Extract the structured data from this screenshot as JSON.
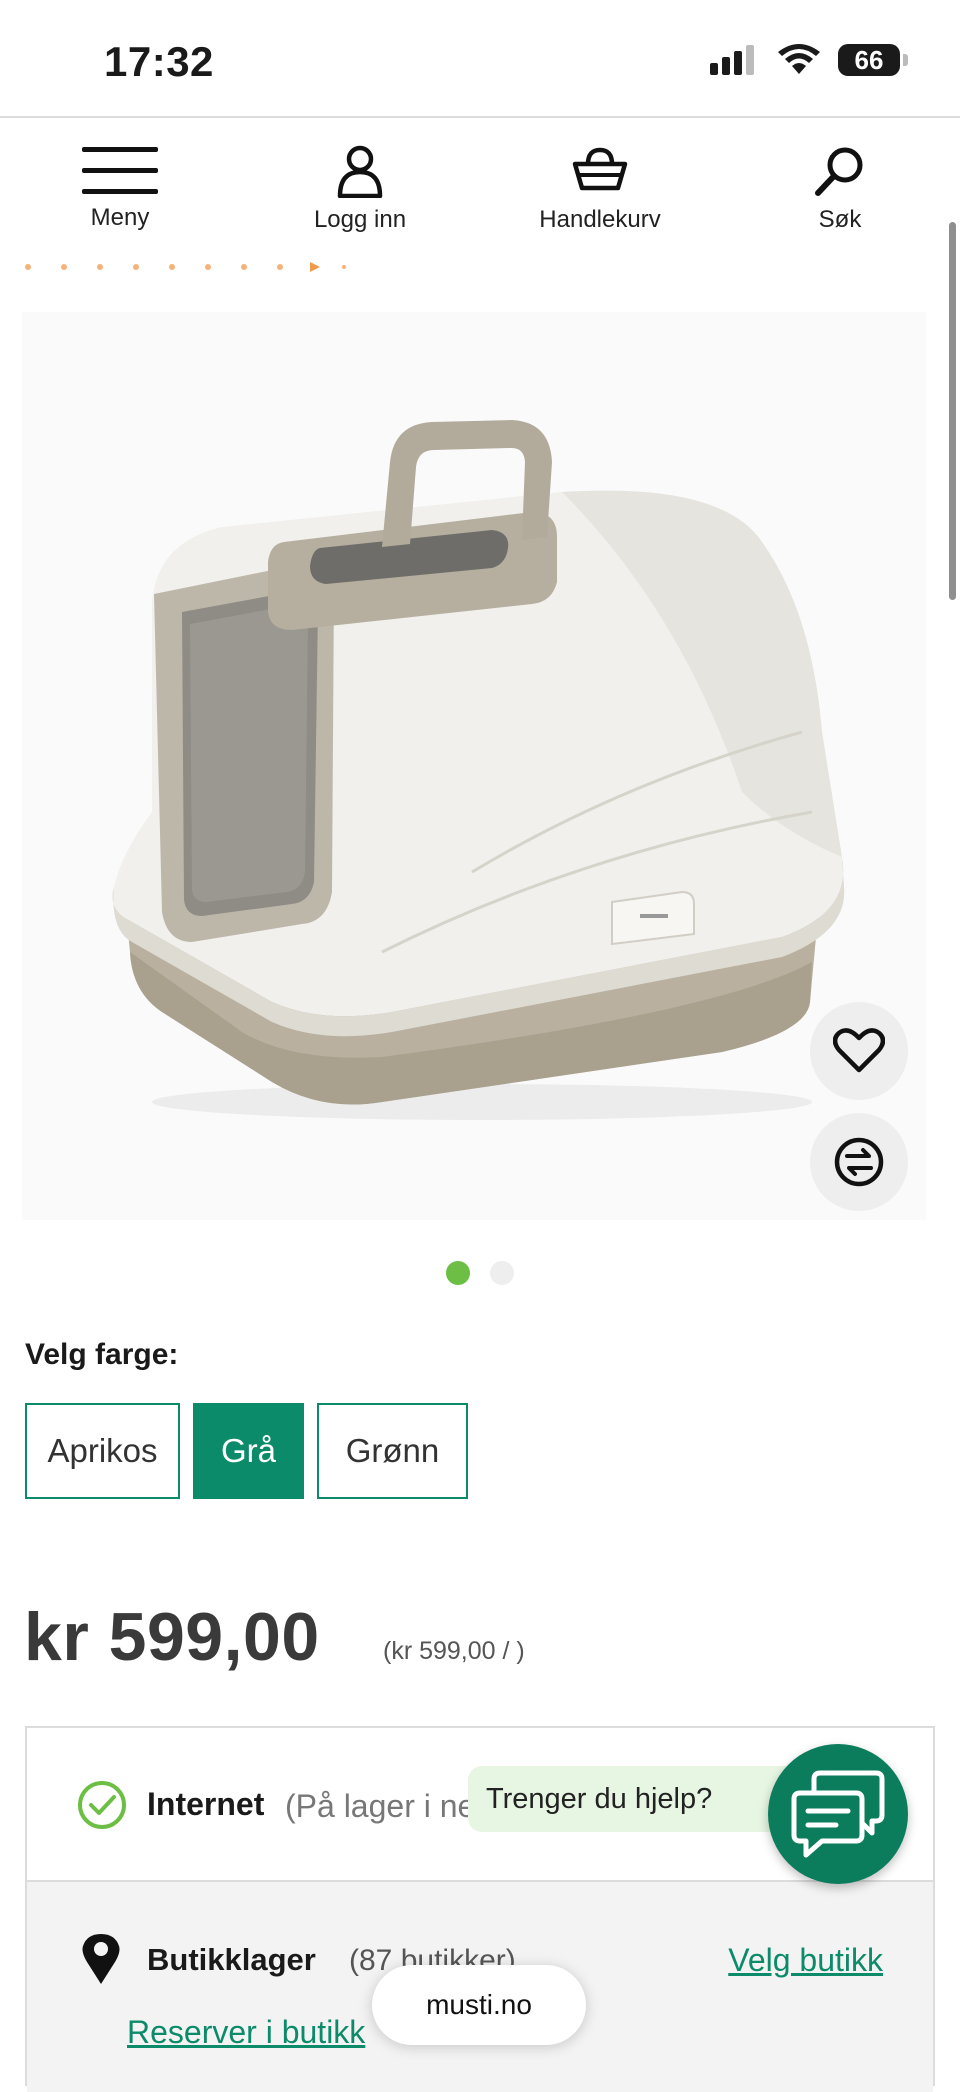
{
  "status_bar": {
    "time": "17:32",
    "battery": "66",
    "icons": [
      "signal-icon",
      "wifi-icon",
      "battery-icon"
    ]
  },
  "nav": {
    "items": [
      {
        "label": "Meny",
        "icon": "hamburger-icon"
      },
      {
        "label": "Logg inn",
        "icon": "user-icon"
      },
      {
        "label": "Handlekurv",
        "icon": "basket-icon"
      },
      {
        "label": "Søk",
        "icon": "search-icon"
      }
    ]
  },
  "gallery": {
    "image": "cat-litter-box-grey",
    "total_images": 2,
    "active_index": 0,
    "icons": [
      "heart-icon",
      "compare-icon"
    ]
  },
  "colors": {
    "label": "Velg farge:",
    "options": [
      "Aprikos",
      "Grå",
      "Grønn"
    ],
    "selected": "Grå"
  },
  "price": {
    "main": "kr 599,00",
    "unit": "(kr 599,00 / )"
  },
  "stock": {
    "internet_label": "Internet",
    "internet_status": "(På lager i nettbutikk)",
    "store_label": "Butikklager",
    "store_count": "(87 butikker)",
    "choose_store": "Velg butikk",
    "reserve": "Reserver i butikk"
  },
  "help": {
    "text": "Trenger du hjelp?"
  },
  "browser": {
    "url": "musti.no"
  },
  "theme": {
    "accent": "#0c8b6a",
    "dot_active": "#6cbf44",
    "chat": "#0c7d5c"
  }
}
